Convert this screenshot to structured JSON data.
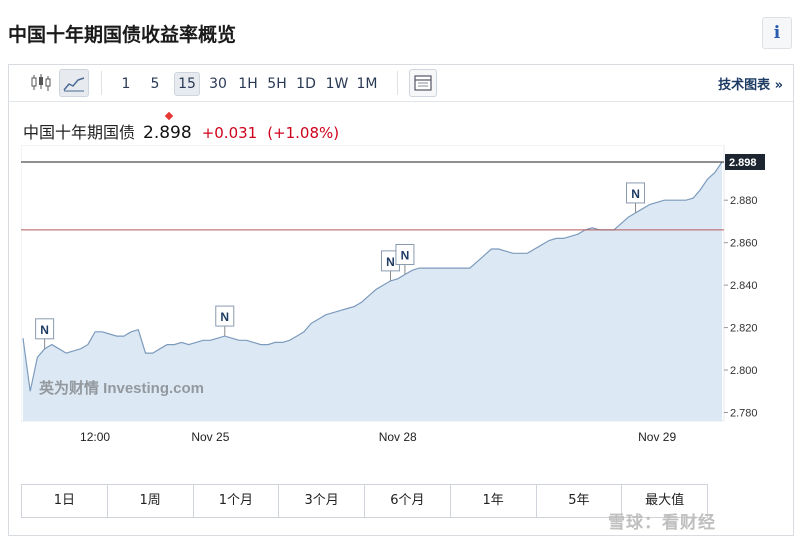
{
  "page": {
    "title": "中国十年期国债收益率概览",
    "info_label": "i"
  },
  "toolbar": {
    "chart_icons": [
      "candlestick-icon",
      "area-chart-icon",
      "table-icon"
    ],
    "intervals": [
      "1",
      "5",
      "15",
      "30",
      "1H",
      "5H",
      "1D",
      "1W",
      "1M"
    ],
    "active_interval": "15",
    "advanced_link": "技术图表 »"
  },
  "quote": {
    "name": "中国十年期国债",
    "price": "2.898",
    "change": "+0.031",
    "change_pct": "(+1.08%)",
    "up_color": "#d0021b"
  },
  "chart_data": {
    "type": "area",
    "title": "",
    "xlabel": "",
    "ylabel": "",
    "ylim": [
      2.776,
      2.906
    ],
    "y_ticks": [
      "2.780",
      "2.800",
      "2.820",
      "2.840",
      "2.860",
      "2.880"
    ],
    "x_tick_labels": [
      "12:00",
      "Nov 25",
      "Nov 28",
      "Nov 29"
    ],
    "last_value_label": "2.898",
    "reference_line": 2.866,
    "news_markers": [
      "N",
      "N",
      "N",
      "N",
      "N"
    ],
    "series": [
      {
        "values": [
          2.815,
          2.79,
          2.806,
          2.81,
          2.812,
          2.81,
          2.808,
          2.809,
          2.81,
          2.812,
          2.818,
          2.818,
          2.817,
          2.816,
          2.816,
          2.818,
          2.819,
          2.808,
          2.808,
          2.81,
          2.812,
          2.812,
          2.813,
          2.812,
          2.813,
          2.814,
          2.814,
          2.815,
          2.816,
          2.815,
          2.814,
          2.814,
          2.813,
          2.812,
          2.812,
          2.813,
          2.813,
          2.814,
          2.816,
          2.818,
          2.822,
          2.824,
          2.826,
          2.827,
          2.828,
          2.829,
          2.83,
          2.832,
          2.835,
          2.838,
          2.84,
          2.842,
          2.843,
          2.845,
          2.847,
          2.848,
          2.848,
          2.848,
          2.848,
          2.848,
          2.848,
          2.848,
          2.848,
          2.851,
          2.854,
          2.857,
          2.857,
          2.856,
          2.855,
          2.855,
          2.855,
          2.857,
          2.859,
          2.861,
          2.862,
          2.862,
          2.863,
          2.864,
          2.866,
          2.867,
          2.866,
          2.866,
          2.866,
          2.869,
          2.872,
          2.874,
          2.876,
          2.878,
          2.879,
          2.88,
          2.88,
          2.88,
          2.88,
          2.881,
          2.885,
          2.89,
          2.893,
          2.898
        ],
        "color": "#7d9bbd",
        "fill": "#dce8f3"
      }
    ]
  },
  "range_tabs": [
    "1日",
    "1周",
    "1个月",
    "3个月",
    "6个月",
    "1年",
    "5年",
    "最大值"
  ],
  "watermarks": {
    "chart": "英为财情 Investing.com",
    "footer": "雪球：看财经"
  }
}
